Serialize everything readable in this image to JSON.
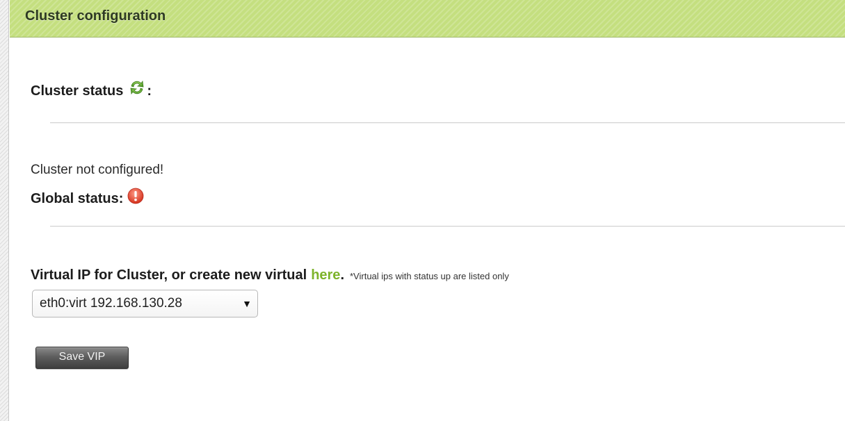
{
  "panel": {
    "title": "Cluster configuration",
    "header_color": "#c4df7f"
  },
  "cluster_status": {
    "label": "Cluster status",
    "suffix": ":",
    "icon": "refresh-icon"
  },
  "status_message": "Cluster not configured!",
  "global_status": {
    "label": "Global status:",
    "icon": "alert-icon",
    "icon_color": "#e0452e"
  },
  "vip": {
    "label": "Virtual IP for Cluster, or create new virtual",
    "link_text": "here",
    "link_color": "#7db32a",
    "punctuation": ".",
    "note": "*Virtual ips with status up are listed only",
    "select_value": "eth0:virt 192.168.130.28"
  },
  "save_button": {
    "label": "Save VIP"
  }
}
